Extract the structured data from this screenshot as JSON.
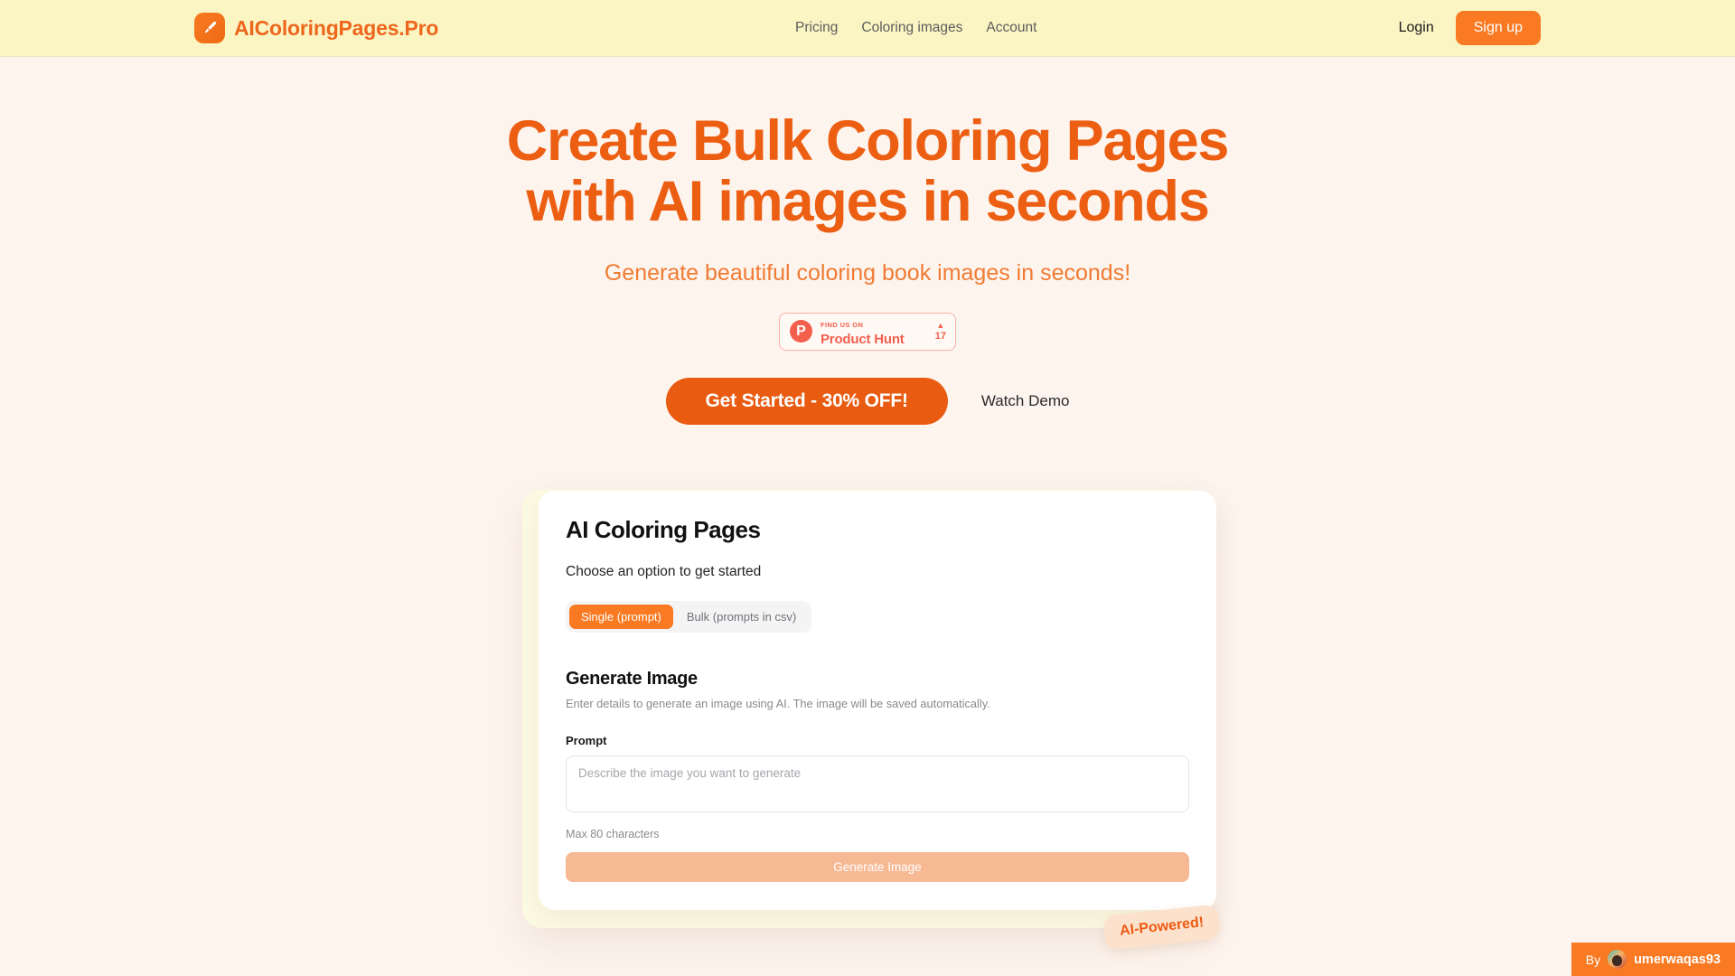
{
  "brand": {
    "name": "AIColoringPages.Pro",
    "icon": "paintbrush-icon",
    "accent": "#EE661C"
  },
  "nav": {
    "items": [
      {
        "label": "Pricing"
      },
      {
        "label": "Coloring images"
      },
      {
        "label": "Account"
      }
    ],
    "login_label": "Login",
    "signup_label": "Sign up"
  },
  "hero": {
    "headline": "Create Bulk Coloring Pages with AI images in seconds",
    "subheadline": "Generate beautiful coloring book images in seconds!",
    "primary_cta": "Get Started - 30% OFF!",
    "secondary_cta": "Watch Demo",
    "headline_color": "#EC5E12",
    "primary_cta_color": "#E85B10"
  },
  "product_hunt": {
    "logo_letter": "P",
    "eyebrow": "FIND US ON",
    "title": "Product Hunt",
    "upvote_caret": "▲",
    "upvote_count": "17",
    "color": "#F2604D"
  },
  "app_card": {
    "title": "AI Coloring Pages",
    "subtitle": "Choose an option to get started",
    "tabs": [
      {
        "label": "Single (prompt)",
        "active": true
      },
      {
        "label": "Bulk (prompts in csv)",
        "active": false
      }
    ],
    "section_title": "Generate Image",
    "section_desc": "Enter details to generate an image using AI. The image will be saved automatically.",
    "prompt_label": "Prompt",
    "prompt_value": "",
    "prompt_placeholder": "Describe the image you want to generate",
    "char_hint": "Max 80 characters",
    "generate_label": "Generate Image",
    "generate_disabled": true
  },
  "floating_badge": {
    "label": "AI-Powered!"
  },
  "attribution": {
    "prefix": "By",
    "username": "umerwaqas93",
    "background": "#F97A22"
  }
}
